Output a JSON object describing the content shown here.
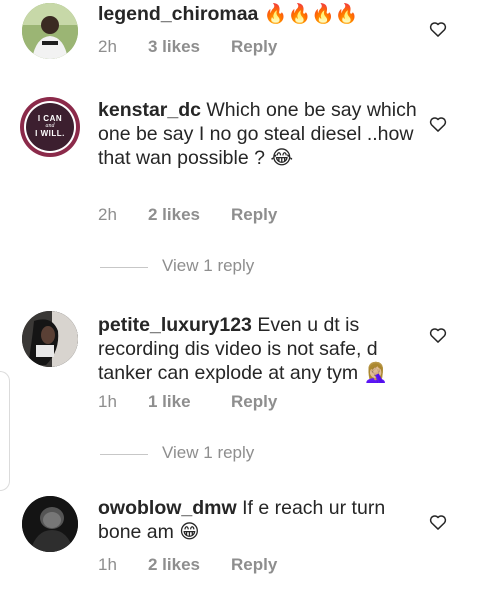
{
  "comments": [
    {
      "username": "legend_chiromaa",
      "text": "🔥🔥🔥🔥",
      "time": "2h",
      "likes": "3 likes",
      "reply": "Reply"
    },
    {
      "username": "kenstar_dc",
      "text": "Which one be say which one be say I no go steal diesel ..how that wan possible ? 😂",
      "time": "2h",
      "likes": "2 likes",
      "reply": "Reply",
      "avatar_text": [
        "I CAN",
        "and",
        "I WILL."
      ],
      "view_replies": "View 1 reply"
    },
    {
      "username": "petite_luxury123",
      "text": "Even u dt is recording dis video is not safe, d tanker can explode at any tym 🤦🏼‍♀️",
      "time": "1h",
      "likes": "1 like",
      "reply": "Reply",
      "view_replies": "View 1 reply"
    },
    {
      "username": "owoblow_dmw",
      "text": "If e reach ur turn bone am 😁",
      "time": "1h",
      "likes": "2 likes",
      "reply": "Reply"
    }
  ],
  "icons": {
    "like": "heart-outline-icon"
  },
  "colors": {
    "text": "#262626",
    "secondary": "#8e8e8e",
    "avatar2_ring": "#8b2a4a",
    "avatar2_bg": "#3c1f2f"
  }
}
